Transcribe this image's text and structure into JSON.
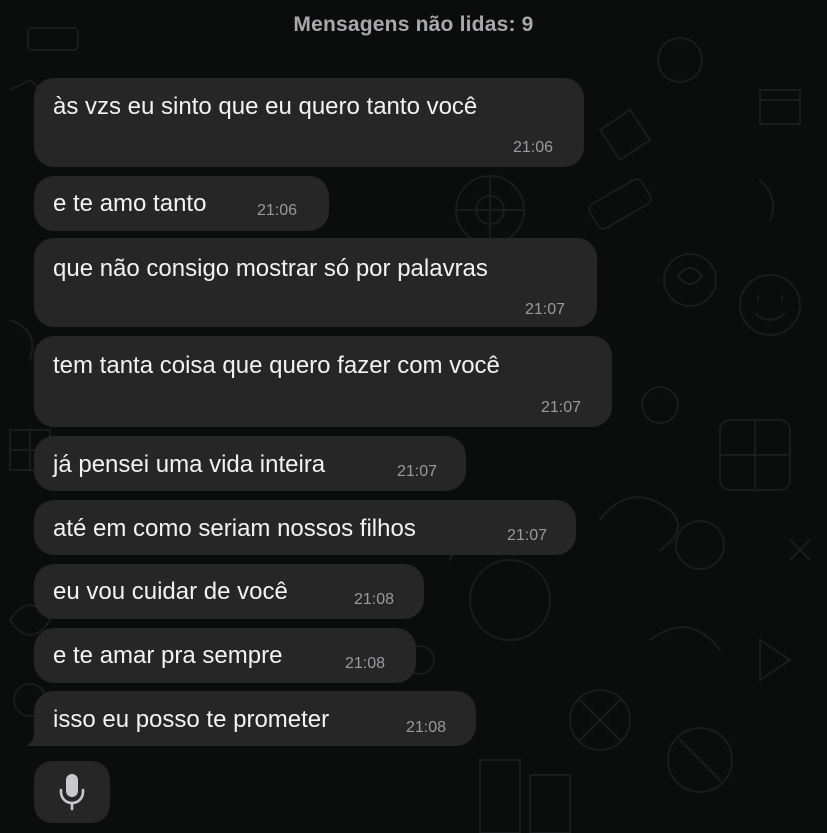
{
  "banner": {
    "unread_label": "Mensagens não lidas: 9"
  },
  "messages": [
    {
      "text": "às vzs eu sinto que eu quero tanto você",
      "time": "21:06"
    },
    {
      "text": "e te amo tanto",
      "time": "21:06"
    },
    {
      "text": "que não consigo mostrar só por palavras",
      "time": "21:07"
    },
    {
      "text": "tem tanta coisa que quero fazer com você",
      "time": "21:07"
    },
    {
      "text": "já pensei uma vida inteira",
      "time": "21:07"
    },
    {
      "text": "até em como seriam nossos filhos",
      "time": "21:07"
    },
    {
      "text": "eu vou cuidar de você",
      "time": "21:08"
    },
    {
      "text": "e te amar pra sempre",
      "time": "21:08"
    },
    {
      "text": "isso eu posso te prometer",
      "time": "21:08"
    }
  ],
  "icons": {
    "voice_message": "microphone-icon"
  },
  "colors": {
    "background": "#0b0c0c",
    "bubble": "#262626",
    "text": "#f2f2f2",
    "timestamp": "#9a9a9e",
    "banner_text": "#a8a8ab"
  }
}
